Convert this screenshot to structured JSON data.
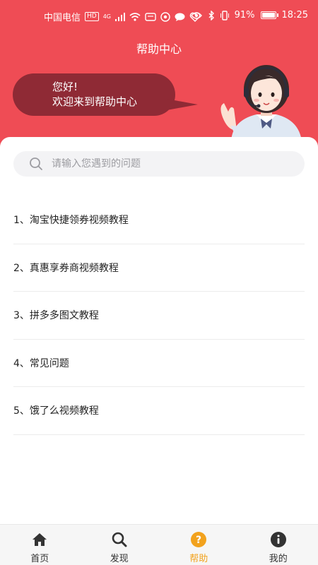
{
  "status_bar": {
    "carrier": "中国电信",
    "hd": "HD",
    "network": "4G",
    "battery": "91%",
    "time": "18:25"
  },
  "header": {
    "title": "帮助中心",
    "greeting_line1": "您好!",
    "greeting_line2": "欢迎来到帮助中心",
    "bg_color": "#ef4c55",
    "bubble_color": "#8f2a35"
  },
  "search": {
    "placeholder": "请输入您遇到的问题",
    "value": ""
  },
  "faq": [
    {
      "label": "1、淘宝快捷领券视频教程"
    },
    {
      "label": "2、真惠享券商视频教程"
    },
    {
      "label": "3、拼多多图文教程"
    },
    {
      "label": "4、常见问题"
    },
    {
      "label": "5、饿了么视频教程"
    }
  ],
  "tabbar": {
    "accent": "#f2a21d",
    "tabs": [
      {
        "label": "首页",
        "icon": "home-icon",
        "active": false
      },
      {
        "label": "发现",
        "icon": "search-icon",
        "active": false
      },
      {
        "label": "帮助",
        "icon": "question-icon",
        "active": true
      },
      {
        "label": "我的",
        "icon": "info-icon",
        "active": false
      }
    ]
  }
}
